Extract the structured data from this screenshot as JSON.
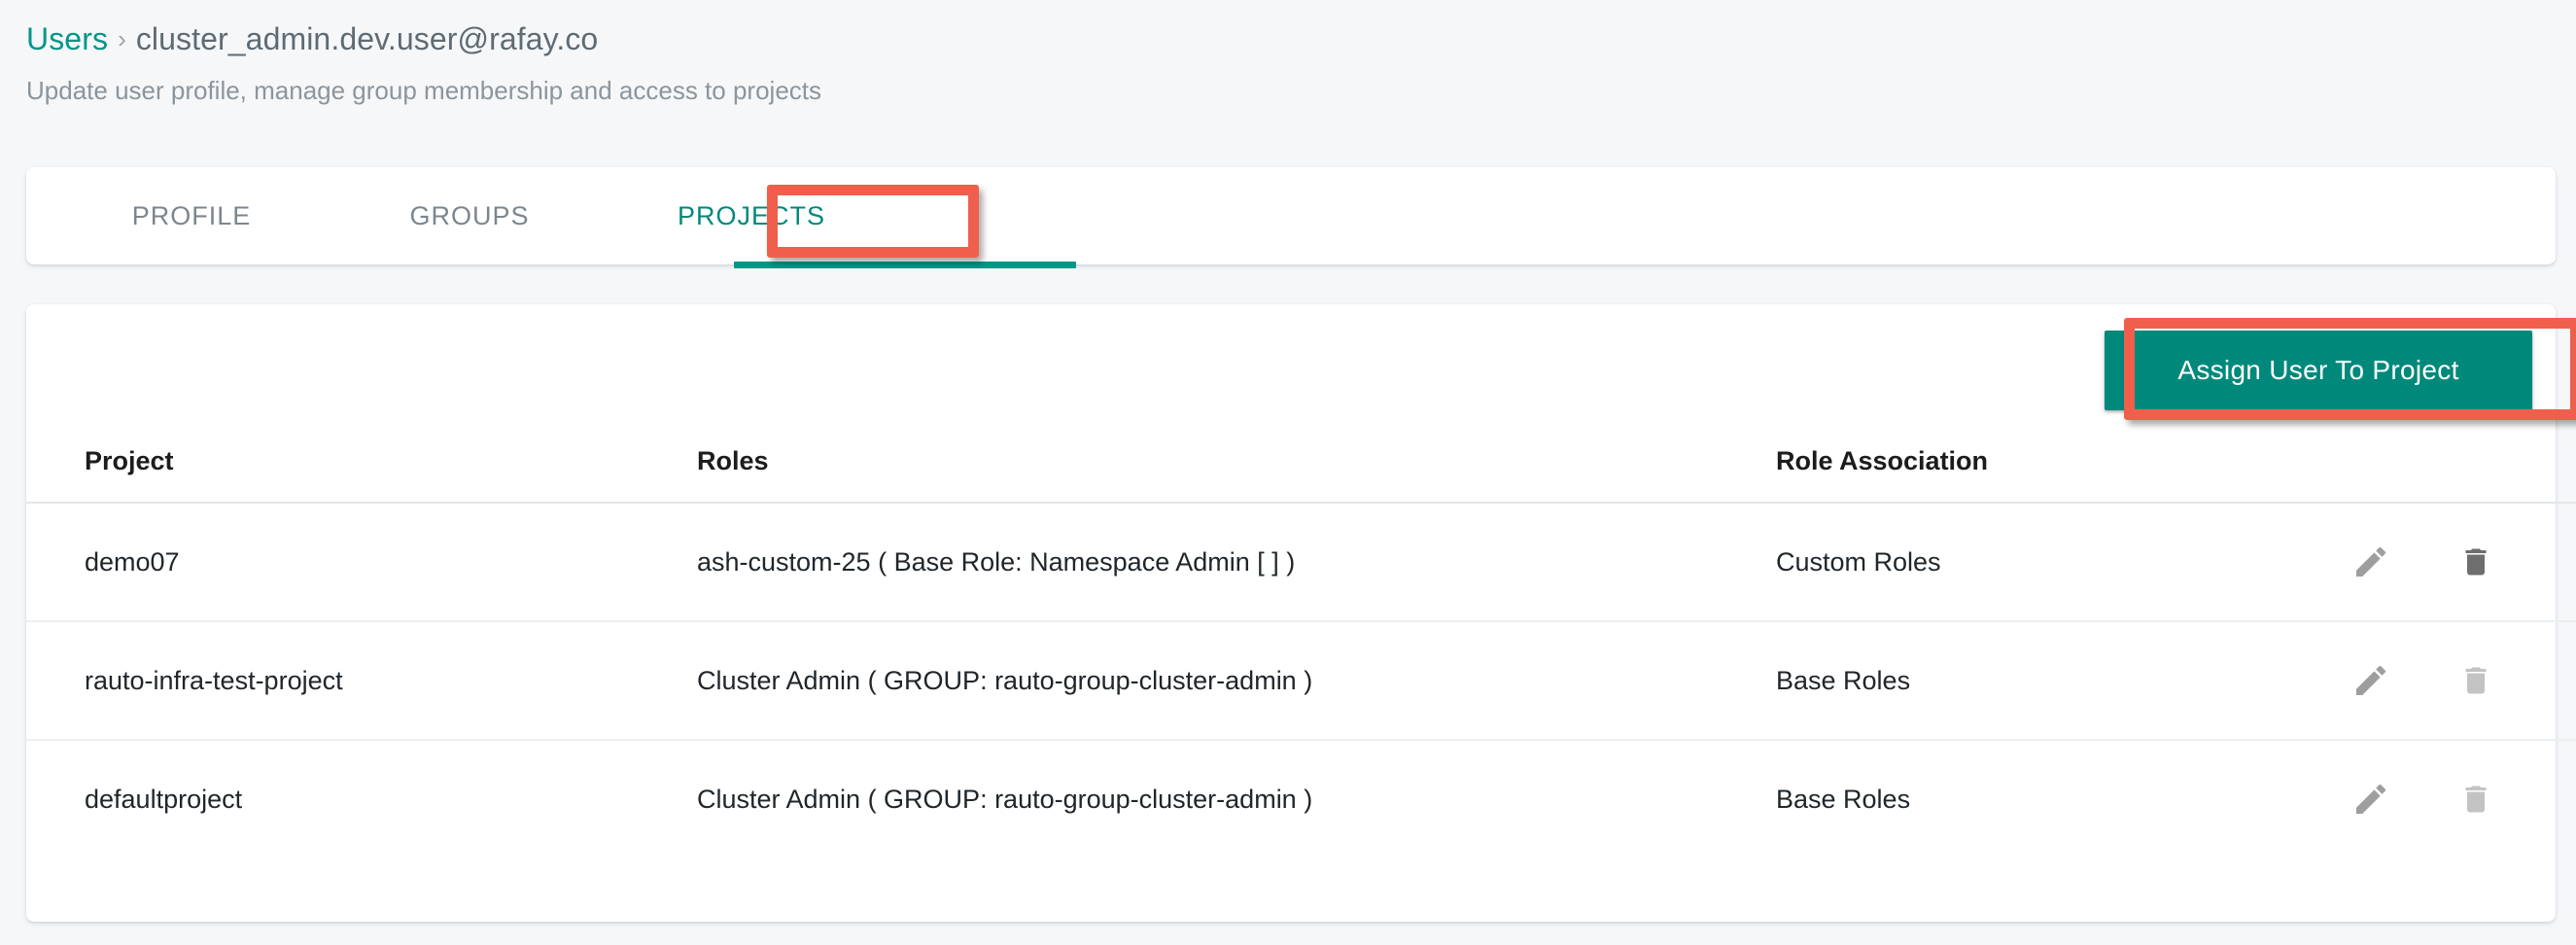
{
  "breadcrumb": {
    "parent": "Users",
    "separator": "›",
    "current": "cluster_admin.dev.user@rafay.co"
  },
  "page": {
    "subtitle": "Update user profile, manage group membership and access to projects"
  },
  "tabs": [
    {
      "label": "PROFILE",
      "active": false
    },
    {
      "label": "GROUPS",
      "active": false
    },
    {
      "label": "PROJECTS",
      "active": true
    }
  ],
  "toolbar": {
    "assign_label": "Assign User To Project"
  },
  "table": {
    "columns": [
      "Project",
      "Roles",
      "Role Association",
      ""
    ],
    "rows": [
      {
        "project": "demo07",
        "roles": "ash-custom-25 ( Base Role: Namespace Admin [ ] )",
        "association": "Custom Roles"
      },
      {
        "project": "rauto-infra-test-project",
        "roles": "Cluster Admin ( GROUP: rauto-group-cluster-admin )",
        "association": "Base Roles"
      },
      {
        "project": "defaultproject",
        "roles": "Cluster Admin ( GROUP: rauto-group-cluster-admin )",
        "association": "Base Roles"
      }
    ]
  },
  "icons": {
    "edit": "pencil-icon",
    "delete": "trash-icon"
  },
  "colors": {
    "accent_teal": "#009688",
    "button_teal": "#00897b",
    "annotation_red": "#ef5f4c",
    "page_background": "#f5f7f9",
    "muted_text": "#8c959c"
  }
}
